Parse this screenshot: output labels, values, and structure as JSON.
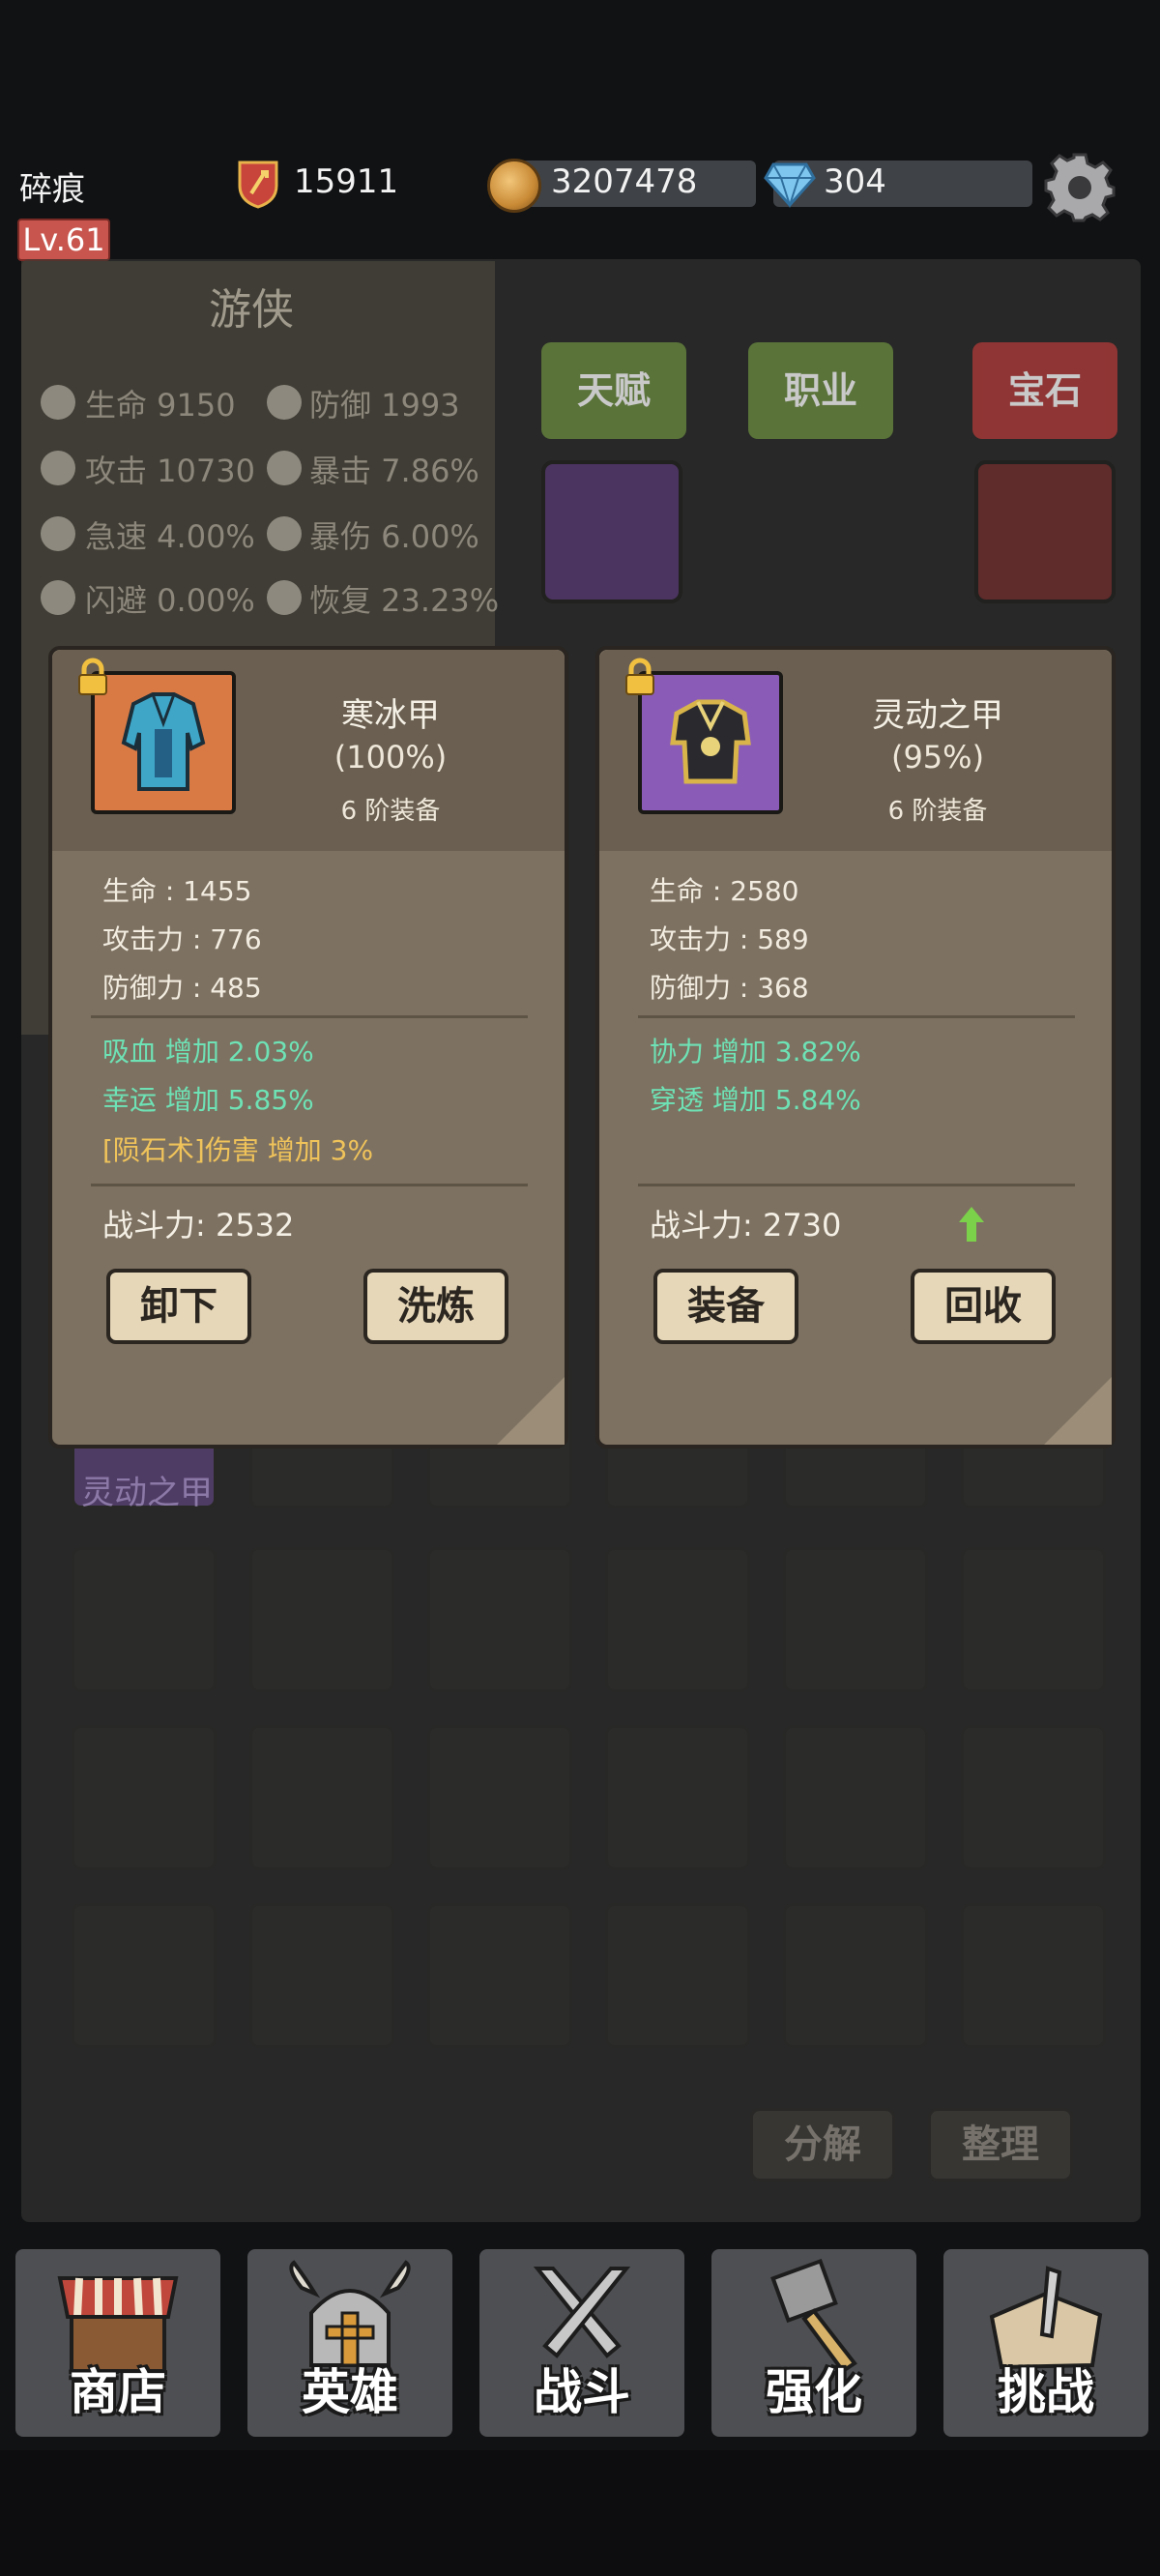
{
  "player": {
    "name": "碎痕",
    "level": "Lv.61",
    "power": "15911"
  },
  "resources": {
    "gold": "3207478",
    "gems": "304"
  },
  "hero": {
    "class_name": "游侠",
    "stats": [
      {
        "label": "生命 9150",
        "icon": "heart-icon"
      },
      {
        "label": "防御 1993",
        "icon": "shield-icon"
      },
      {
        "label": "攻击 10730",
        "icon": "sword-icon"
      },
      {
        "label": "暴击 7.86%",
        "icon": "flame-icon"
      },
      {
        "label": "急速 4.00%",
        "icon": "speed-icon"
      },
      {
        "label": "暴伤 6.00%",
        "icon": "burst-icon"
      },
      {
        "label": "闪避 0.00%",
        "icon": "dodge-icon"
      },
      {
        "label": "恢复 23.23%",
        "icon": "heal-icon"
      }
    ]
  },
  "tabs": {
    "talent": "天赋",
    "job": "职业",
    "gem": "宝石"
  },
  "inventory": {
    "visible_item_label": "灵动之甲",
    "decompose": "分解",
    "organize": "整理"
  },
  "left_card": {
    "name": "寒冰甲",
    "percent": "(100%)",
    "tier": "6 阶装备",
    "attrs": [
      "生命 : 1455",
      "攻击力 : 776",
      "防御力 : 485"
    ],
    "bonuses": [
      "吸血 增加 2.03%",
      "幸运 增加 5.85%"
    ],
    "special": "[陨石术]伤害 增加 3%",
    "score": "战斗力: 2532",
    "btn_left": "卸下",
    "btn_right": "洗炼",
    "frame_color": "#d97a45"
  },
  "right_card": {
    "name": "灵动之甲",
    "percent": "(95%)",
    "tier": "6 阶装备",
    "attrs": [
      "生命 : 2580",
      "攻击力 : 589",
      "防御力 : 368"
    ],
    "bonuses": [
      "协力 增加 3.82%",
      "穿透 增加 5.84%"
    ],
    "score": "战斗力: 2730",
    "btn_left": "装备",
    "btn_right": "回收",
    "frame_color": "#8a5cb8"
  },
  "nav": {
    "shop": "商店",
    "hero": "英雄",
    "battle": "战斗",
    "enhance": "强化",
    "challenge": "挑战"
  }
}
